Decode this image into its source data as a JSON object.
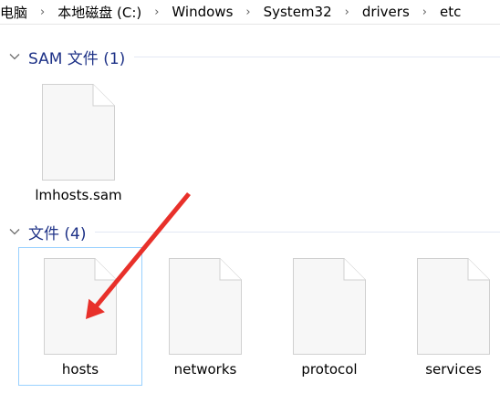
{
  "breadcrumb": {
    "items": [
      "电脑",
      "本地磁盘 (C:)",
      "Windows",
      "System32",
      "drivers",
      "etc"
    ],
    "separator": "›"
  },
  "groups": [
    {
      "title": "SAM 文件 (1)",
      "files": [
        "lmhosts.sam"
      ]
    },
    {
      "title": "文件 (4)",
      "files": [
        "hosts",
        "networks",
        "protocol",
        "services"
      ]
    }
  ],
  "selected_file": "hosts",
  "colors": {
    "group_title": "#1e3287",
    "selection_border": "#99d1ff",
    "annotation_arrow": "#e8302a"
  },
  "icons": {
    "group_toggle": "chevron-down-icon",
    "file": "document-icon"
  }
}
